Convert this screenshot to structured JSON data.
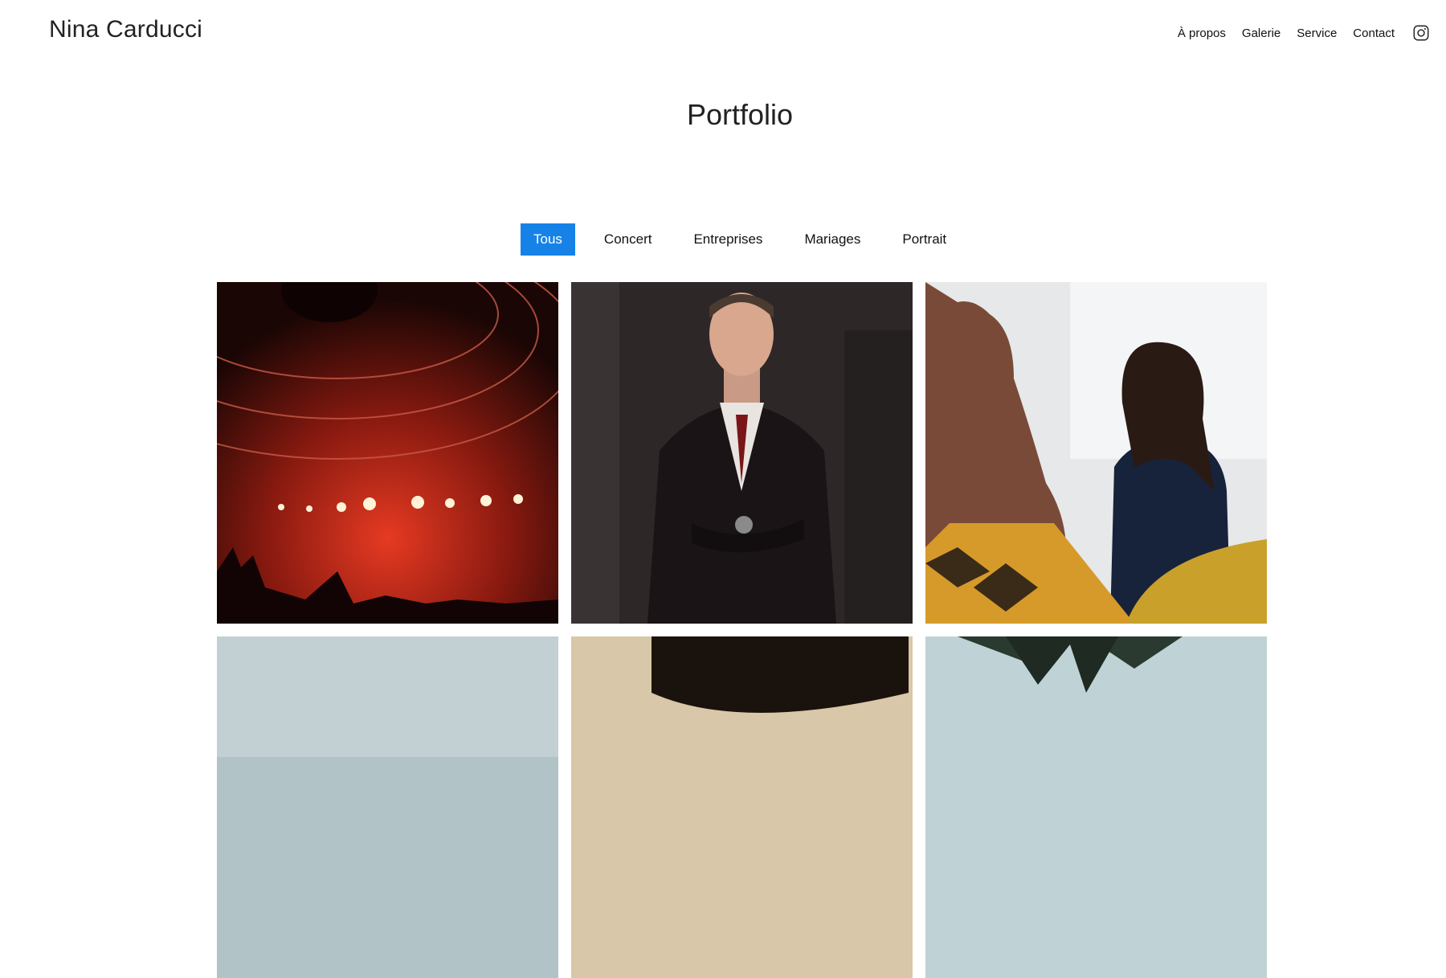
{
  "header": {
    "brand": "Nina Carducci",
    "nav": [
      "À propos",
      "Galerie",
      "Service",
      "Contact"
    ],
    "social_icon": "instagram-icon"
  },
  "main": {
    "title": "Portfolio",
    "filters": [
      {
        "label": "Tous",
        "active": true
      },
      {
        "label": "Concert",
        "active": false
      },
      {
        "label": "Entreprises",
        "active": false
      },
      {
        "label": "Mariages",
        "active": false
      },
      {
        "label": "Portrait",
        "active": false
      }
    ],
    "active_color": "#1682e8",
    "gallery": [
      {
        "subject": "concert-stage-red-lights"
      },
      {
        "subject": "businessman-in-suit"
      },
      {
        "subject": "smiling-woman-in-office"
      },
      {
        "subject": "pale-sky-scene"
      },
      {
        "subject": "curly-hair-portrait"
      },
      {
        "subject": "palm-trees"
      }
    ]
  }
}
